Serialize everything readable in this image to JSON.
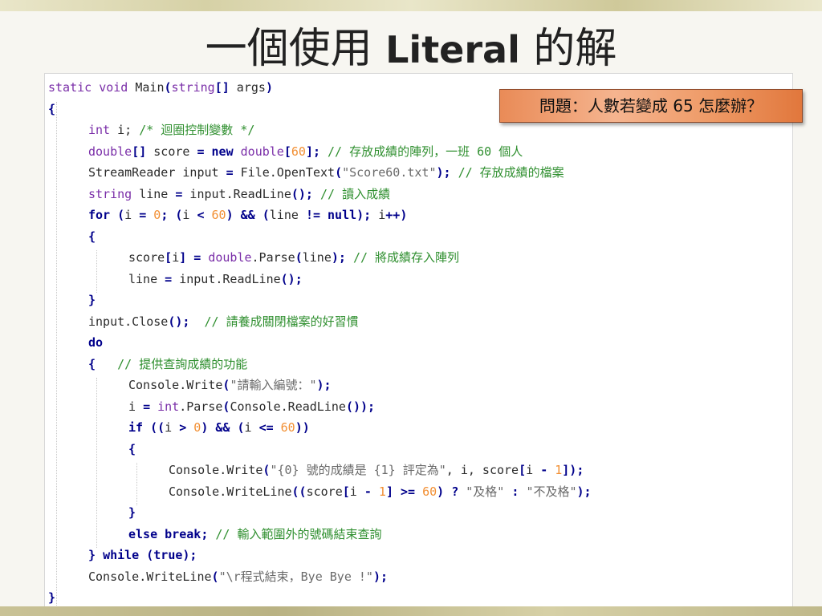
{
  "slide": {
    "title_part1": "一個使用",
    "title_keyword": "Literal",
    "title_part2": "的解",
    "callout": "問題：人數若變成 65 怎麼辦？"
  },
  "code": {
    "language": "C#",
    "lines": [
      {
        "indent": 0,
        "tokens": [
          {
            "t": "static void",
            "k": "type"
          },
          {
            "t": " Main",
            "k": "text"
          },
          {
            "t": "(",
            "k": "punc"
          },
          {
            "t": "string",
            "k": "type"
          },
          {
            "t": "[]",
            "k": "punc"
          },
          {
            "t": " args",
            "k": "text"
          },
          {
            "t": ")",
            "k": "punc"
          }
        ]
      },
      {
        "indent": 0,
        "tokens": [
          {
            "t": "{",
            "k": "punc"
          }
        ]
      },
      {
        "indent": 1,
        "tokens": [
          {
            "t": "int",
            "k": "type"
          },
          {
            "t": " i",
            "k": "text"
          },
          {
            "t": ";",
            "k": "text"
          },
          {
            "t": " /* 迴圈控制變數 */",
            "k": "comment"
          }
        ]
      },
      {
        "indent": 1,
        "tokens": [
          {
            "t": "double",
            "k": "type"
          },
          {
            "t": "[]",
            "k": "punc"
          },
          {
            "t": " score ",
            "k": "text"
          },
          {
            "t": "=",
            "k": "punc"
          },
          {
            "t": " ",
            "k": "text"
          },
          {
            "t": "new",
            "k": "kw"
          },
          {
            "t": " ",
            "k": "text"
          },
          {
            "t": "double",
            "k": "type"
          },
          {
            "t": "[",
            "k": "punc"
          },
          {
            "t": "60",
            "k": "num"
          },
          {
            "t": "];",
            "k": "punc"
          },
          {
            "t": " // 存放成績的陣列，一班 60 個人",
            "k": "comment"
          }
        ]
      },
      {
        "indent": 1,
        "tokens": [
          {
            "t": "StreamReader input ",
            "k": "text"
          },
          {
            "t": "=",
            "k": "punc"
          },
          {
            "t": " File.OpenText",
            "k": "text"
          },
          {
            "t": "(",
            "k": "punc"
          },
          {
            "t": "\"Score60.txt\"",
            "k": "str"
          },
          {
            "t": ");",
            "k": "punc"
          },
          {
            "t": " // 存放成績的檔案",
            "k": "comment"
          }
        ]
      },
      {
        "indent": 1,
        "tokens": [
          {
            "t": "string",
            "k": "type"
          },
          {
            "t": " line ",
            "k": "text"
          },
          {
            "t": "=",
            "k": "punc"
          },
          {
            "t": " input.ReadLine",
            "k": "text"
          },
          {
            "t": "();",
            "k": "punc"
          },
          {
            "t": " // 讀入成績",
            "k": "comment"
          }
        ]
      },
      {
        "indent": 1,
        "tokens": [
          {
            "t": "for",
            "k": "kw"
          },
          {
            "t": " (",
            "k": "punc"
          },
          {
            "t": "i ",
            "k": "text"
          },
          {
            "t": "=",
            "k": "punc"
          },
          {
            "t": " ",
            "k": "text"
          },
          {
            "t": "0",
            "k": "num"
          },
          {
            "t": ";",
            "k": "punc"
          },
          {
            "t": " (",
            "k": "punc"
          },
          {
            "t": "i ",
            "k": "text"
          },
          {
            "t": "<",
            "k": "punc"
          },
          {
            "t": " ",
            "k": "text"
          },
          {
            "t": "60",
            "k": "num"
          },
          {
            "t": ")",
            "k": "punc"
          },
          {
            "t": " && (",
            "k": "punc"
          },
          {
            "t": "line ",
            "k": "text"
          },
          {
            "t": "!=",
            "k": "punc"
          },
          {
            "t": " ",
            "k": "text"
          },
          {
            "t": "null",
            "k": "kw"
          },
          {
            "t": ");",
            "k": "punc"
          },
          {
            "t": " i",
            "k": "text"
          },
          {
            "t": "++)",
            "k": "punc"
          }
        ]
      },
      {
        "indent": 1,
        "tokens": [
          {
            "t": "{",
            "k": "punc"
          }
        ]
      },
      {
        "indent": 2,
        "tokens": [
          {
            "t": "score",
            "k": "text"
          },
          {
            "t": "[",
            "k": "punc"
          },
          {
            "t": "i",
            "k": "text"
          },
          {
            "t": "]",
            "k": "punc"
          },
          {
            "t": " ",
            "k": "text"
          },
          {
            "t": "=",
            "k": "punc"
          },
          {
            "t": " ",
            "k": "text"
          },
          {
            "t": "double",
            "k": "type"
          },
          {
            "t": ".Parse",
            "k": "text"
          },
          {
            "t": "(",
            "k": "punc"
          },
          {
            "t": "line",
            "k": "text"
          },
          {
            "t": ");",
            "k": "punc"
          },
          {
            "t": " // 將成績存入陣列",
            "k": "comment"
          }
        ]
      },
      {
        "indent": 2,
        "tokens": [
          {
            "t": "line ",
            "k": "text"
          },
          {
            "t": "=",
            "k": "punc"
          },
          {
            "t": " input.ReadLine",
            "k": "text"
          },
          {
            "t": "();",
            "k": "punc"
          }
        ]
      },
      {
        "indent": 1,
        "tokens": [
          {
            "t": "}",
            "k": "punc"
          }
        ]
      },
      {
        "indent": 1,
        "tokens": [
          {
            "t": "input.Close",
            "k": "text"
          },
          {
            "t": "();",
            "k": "punc"
          },
          {
            "t": "  // 請養成關閉檔案的好習慣",
            "k": "comment"
          }
        ]
      },
      {
        "indent": 1,
        "tokens": [
          {
            "t": "do",
            "k": "kw"
          }
        ]
      },
      {
        "indent": 1,
        "tokens": [
          {
            "t": "{",
            "k": "punc"
          },
          {
            "t": "   // 提供查詢成績的功能",
            "k": "comment"
          }
        ]
      },
      {
        "indent": 2,
        "tokens": [
          {
            "t": "Console.Write",
            "k": "text"
          },
          {
            "t": "(",
            "k": "punc"
          },
          {
            "t": "\"請輸入編號：\"",
            "k": "str"
          },
          {
            "t": ");",
            "k": "punc"
          }
        ]
      },
      {
        "indent": 2,
        "tokens": [
          {
            "t": "i ",
            "k": "text"
          },
          {
            "t": "=",
            "k": "punc"
          },
          {
            "t": " ",
            "k": "text"
          },
          {
            "t": "int",
            "k": "type"
          },
          {
            "t": ".Parse",
            "k": "text"
          },
          {
            "t": "(",
            "k": "punc"
          },
          {
            "t": "Console.ReadLine",
            "k": "text"
          },
          {
            "t": "());",
            "k": "punc"
          }
        ]
      },
      {
        "indent": 2,
        "tokens": [
          {
            "t": "if",
            "k": "kw"
          },
          {
            "t": " ((",
            "k": "punc"
          },
          {
            "t": "i ",
            "k": "text"
          },
          {
            "t": ">",
            "k": "punc"
          },
          {
            "t": " ",
            "k": "text"
          },
          {
            "t": "0",
            "k": "num"
          },
          {
            "t": ")",
            "k": "punc"
          },
          {
            "t": " && (",
            "k": "punc"
          },
          {
            "t": "i ",
            "k": "text"
          },
          {
            "t": "<=",
            "k": "punc"
          },
          {
            "t": " ",
            "k": "text"
          },
          {
            "t": "60",
            "k": "num"
          },
          {
            "t": "))",
            "k": "punc"
          }
        ]
      },
      {
        "indent": 2,
        "tokens": [
          {
            "t": "{",
            "k": "punc"
          }
        ]
      },
      {
        "indent": 3,
        "tokens": [
          {
            "t": "Console.Write",
            "k": "text"
          },
          {
            "t": "(",
            "k": "punc"
          },
          {
            "t": "\"{0} 號的成績是 {1} 評定為\"",
            "k": "str"
          },
          {
            "t": ", i, score",
            "k": "text"
          },
          {
            "t": "[",
            "k": "punc"
          },
          {
            "t": "i ",
            "k": "text"
          },
          {
            "t": "-",
            "k": "punc"
          },
          {
            "t": " ",
            "k": "text"
          },
          {
            "t": "1",
            "k": "num"
          },
          {
            "t": "]);",
            "k": "punc"
          }
        ]
      },
      {
        "indent": 3,
        "tokens": [
          {
            "t": "Console.WriteLine",
            "k": "text"
          },
          {
            "t": "((",
            "k": "punc"
          },
          {
            "t": "score",
            "k": "text"
          },
          {
            "t": "[",
            "k": "punc"
          },
          {
            "t": "i ",
            "k": "text"
          },
          {
            "t": "-",
            "k": "punc"
          },
          {
            "t": " ",
            "k": "text"
          },
          {
            "t": "1",
            "k": "num"
          },
          {
            "t": "]",
            "k": "punc"
          },
          {
            "t": " ",
            "k": "text"
          },
          {
            "t": ">=",
            "k": "punc"
          },
          {
            "t": " ",
            "k": "text"
          },
          {
            "t": "60",
            "k": "num"
          },
          {
            "t": ")",
            "k": "punc"
          },
          {
            "t": " ? ",
            "k": "punc"
          },
          {
            "t": "\"及格\"",
            "k": "str"
          },
          {
            "t": " : ",
            "k": "punc"
          },
          {
            "t": "\"不及格\"",
            "k": "str"
          },
          {
            "t": ");",
            "k": "punc"
          }
        ]
      },
      {
        "indent": 2,
        "tokens": [
          {
            "t": "}",
            "k": "punc"
          }
        ]
      },
      {
        "indent": 2,
        "tokens": [
          {
            "t": "else break",
            "k": "kw"
          },
          {
            "t": ";",
            "k": "punc"
          },
          {
            "t": " // 輸入範圍外的號碼結束查詢",
            "k": "comment"
          }
        ]
      },
      {
        "indent": 1,
        "tokens": [
          {
            "t": "}",
            "k": "punc"
          },
          {
            "t": " ",
            "k": "text"
          },
          {
            "t": "while",
            "k": "kw"
          },
          {
            "t": " (",
            "k": "punc"
          },
          {
            "t": "true",
            "k": "kw"
          },
          {
            "t": ");",
            "k": "punc"
          }
        ]
      },
      {
        "indent": 1,
        "tokens": [
          {
            "t": "Console.WriteLine",
            "k": "text"
          },
          {
            "t": "(",
            "k": "punc"
          },
          {
            "t": "\"\\r程式結束，Bye Bye !\"",
            "k": "str"
          },
          {
            "t": ");",
            "k": "punc"
          }
        ]
      },
      {
        "indent": 0,
        "tokens": [
          {
            "t": "}",
            "k": "punc"
          }
        ]
      }
    ]
  }
}
